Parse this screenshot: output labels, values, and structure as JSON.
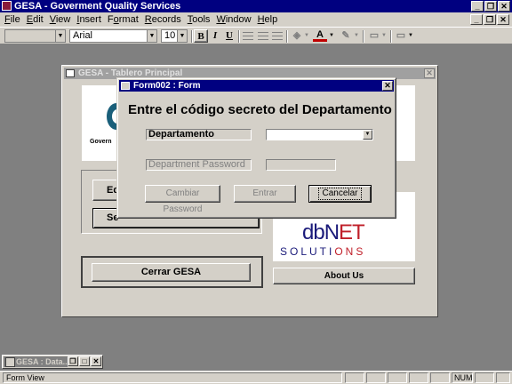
{
  "app": {
    "title": "GESA - Goverment Quality Services"
  },
  "menu": {
    "items": [
      {
        "key": "F",
        "rest": "ile"
      },
      {
        "key": "E",
        "rest": "dit"
      },
      {
        "key": "V",
        "rest": "iew"
      },
      {
        "key": "I",
        "rest": "nsert"
      },
      {
        "key": "F",
        "rest": "ormat",
        "pre": ""
      },
      {
        "key": "R",
        "rest": "ecords"
      },
      {
        "key": "T",
        "rest": "ools"
      },
      {
        "key": "W",
        "rest": "indow"
      },
      {
        "key": "H",
        "rest": "elp"
      }
    ]
  },
  "toolbar": {
    "font_name": "Arial",
    "font_size": "10",
    "bold_label": "B",
    "italic_label": "I",
    "underline_label": "U",
    "font_color_label": "A"
  },
  "tablero": {
    "title": "GESA - Tablero Principal",
    "gov_logo_text": "Govern",
    "btn_eq_label": "Eq",
    "btn_se_label": "Se",
    "cerrar_label": "Cerrar GESA",
    "about_label": "About Us",
    "dbnet_db": "db",
    "dbnet_n": "N",
    "dbnet_et": "ET",
    "dbnet_solutions_a": "SOLUTI",
    "dbnet_solutions_b": "ONS"
  },
  "form002": {
    "title": "Form002 : Form",
    "heading": "Entre el código secreto del Departamento",
    "dept_label": "Departamento",
    "dept_value": "",
    "pass_label": "Department Password",
    "pass_value": "",
    "cambiar_label": "Cambiar Password",
    "entrar_label": "Entrar",
    "cancelar_label": "Cancelar"
  },
  "minimized": {
    "title": "GESA : Data..."
  },
  "status": {
    "text": "Form View",
    "num": "NUM"
  },
  "colors": {
    "titlebar_active": "#000080",
    "titlebar_inactive": "#a0a0a0",
    "face": "#d4d0c8",
    "workspace": "#808080"
  }
}
